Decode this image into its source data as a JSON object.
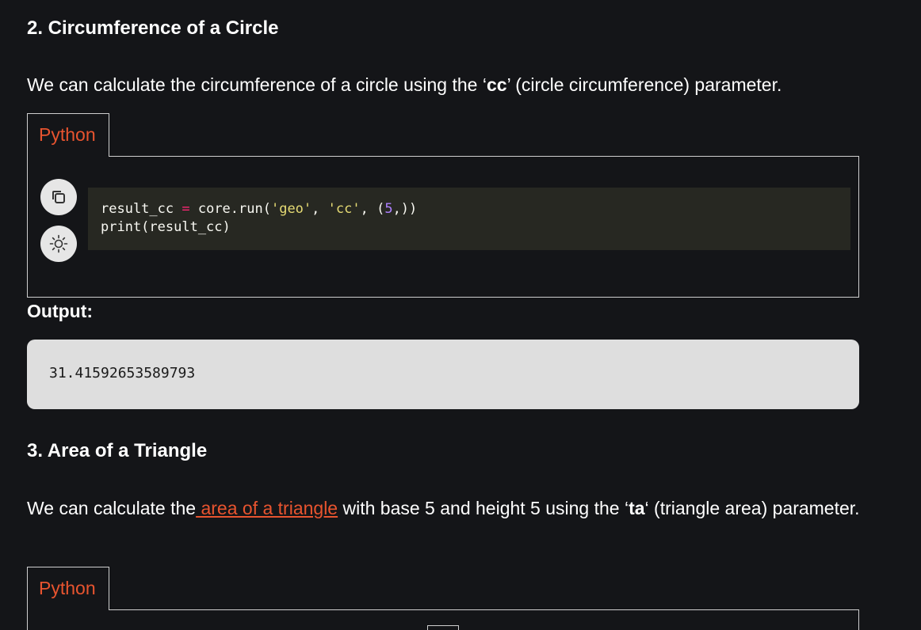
{
  "section2": {
    "heading": "2. Circumference of a Circle",
    "para_before": "We can calculate the circumference of a circle using the ‘",
    "para_bold": "cc",
    "para_after": "’ (circle circumference) parameter.",
    "tab_label": "Python",
    "code": {
      "line1": {
        "var": "result_cc ",
        "op": "=",
        "call": " core.run(",
        "str1": "'geo'",
        "sep1": ", ",
        "str2": "'cc'",
        "sep2": ", (",
        "num": "5",
        "end": ",))"
      },
      "line2": "print(result_cc)"
    },
    "icons": {
      "copy": "copy-icon",
      "theme": "sun-icon"
    },
    "output_label": "Output:",
    "output_value": "31.41592653589793"
  },
  "section3": {
    "heading": "3. Area of a Triangle",
    "para_before": "We can calculate the",
    "link_text": " area of a triangle",
    "para_middle": " with base 5 and height 5 using the ‘",
    "para_bold": "ta",
    "para_after": "‘ (triangle area) parameter.",
    "tab_label": "Python"
  },
  "colors": {
    "background": "#141518",
    "accent": "#e8542f",
    "code_bg": "#272822",
    "output_bg": "#dedede"
  }
}
